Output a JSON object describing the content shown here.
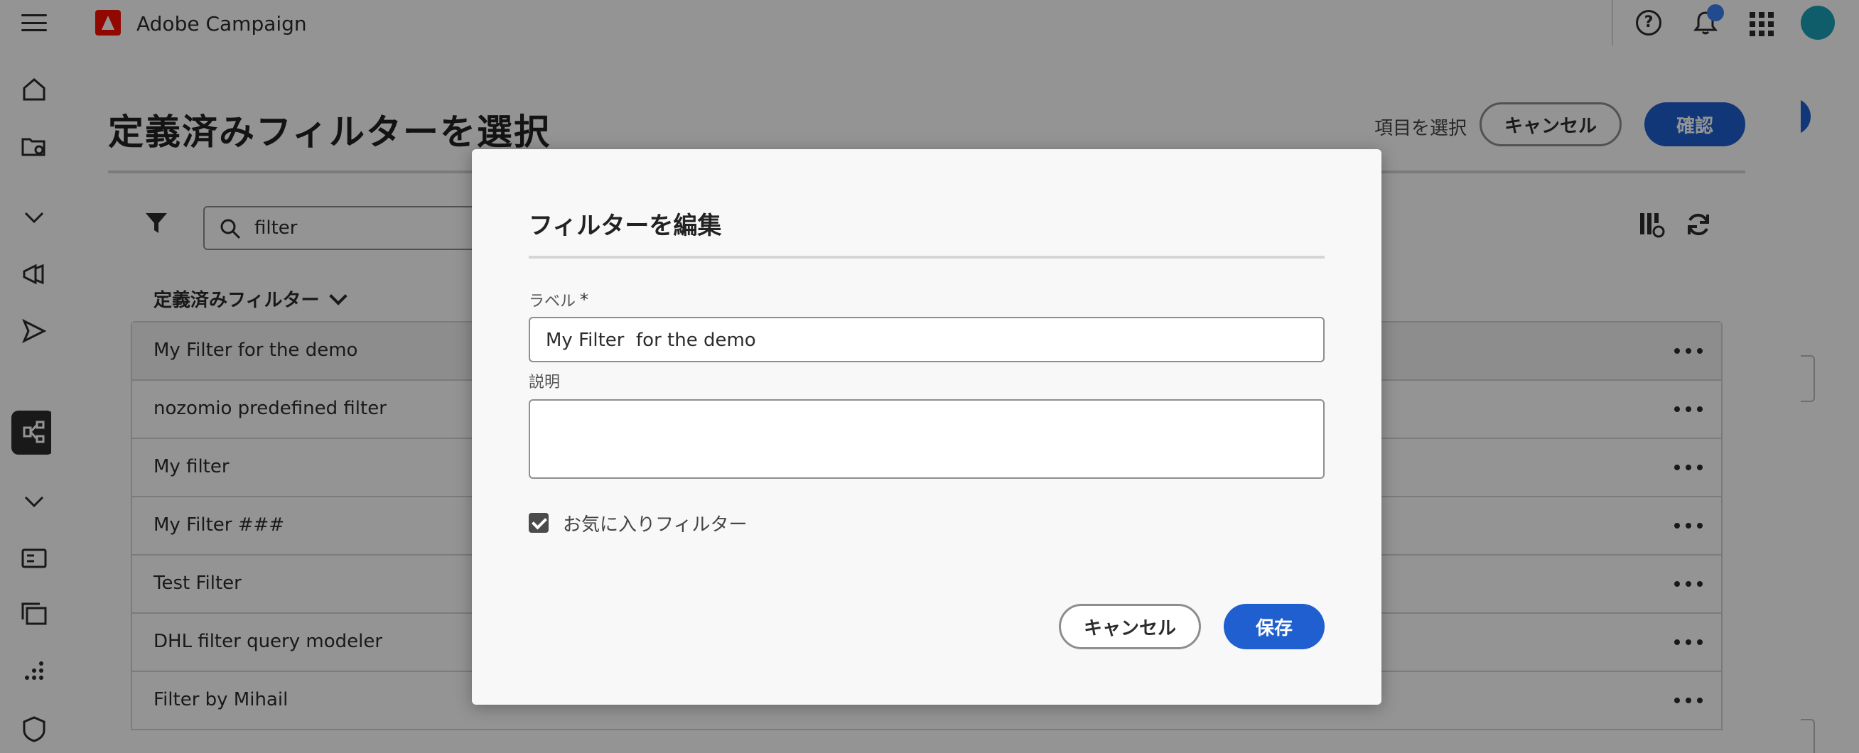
{
  "topbar": {
    "app_name": "Adobe Campaign",
    "icons": [
      "menu-icon",
      "adobe-logo-icon",
      "help-icon",
      "bell-icon",
      "apps-grid-icon",
      "avatar"
    ],
    "help_glyph": "?"
  },
  "select_dialog": {
    "title": "定義済みフィルターを選択",
    "hint": "項目を選択",
    "cancel_label": "キャンセル",
    "confirm_label": "確認",
    "search_value": "filter",
    "column_header": "定義済みフィルター",
    "rows": [
      "My Filter for the demo",
      "nozomio predefined filter",
      "My filter",
      "My Filter ###",
      "Test Filter",
      "DHL filter query modeler",
      "Filter by Mihail"
    ]
  },
  "edit_modal": {
    "title": "フィルターを編集",
    "label_field_label": "ラベル",
    "required_marker": "*",
    "label_value": "My Filter  for the demo",
    "description_label": "説明",
    "description_value": "",
    "favorite_label": "お気に入りフィルター",
    "favorite_checked": true,
    "cancel_label": "キャンセル",
    "save_label": "保存"
  },
  "colors": {
    "accent": "#1f5fcf",
    "overlay": "rgba(0,0,0,0.42)",
    "brand": "#fa0f00"
  }
}
